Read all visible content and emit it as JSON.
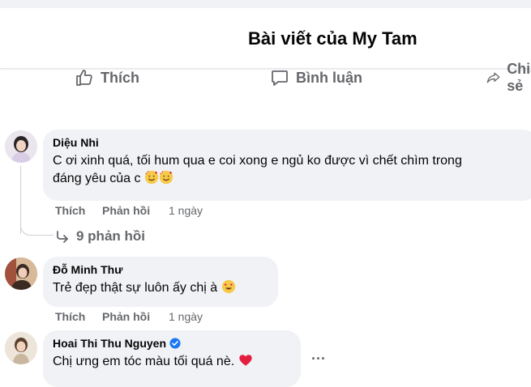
{
  "header": {
    "title": "Bài viết của My Tam"
  },
  "actions": {
    "like": "Thích",
    "comment": "Bình luận",
    "share": "Chia sẻ"
  },
  "comments": [
    {
      "author": "Diệu Nhi",
      "text_line1": "C ơi xinh quá, tối hum qua e coi xong e ngủ ko được vì chết chìm trong",
      "text_line2": "đáng yêu của c",
      "like_label": "Thích",
      "reply_label": "Phản hồi",
      "time": "1 ngày",
      "replies_label": "9 phản hồi"
    },
    {
      "author": "Đỗ Minh Thư",
      "text": "Trẻ đẹp thật sự luôn ấy chị à",
      "like_label": "Thích",
      "reply_label": "Phản hồi",
      "time": "1 ngày"
    },
    {
      "author": "Hoai Thi Thu Nguyen",
      "text": "Chị ưng em tóc màu tối quá nè.",
      "verified": true,
      "more": "..."
    }
  ],
  "icons": {
    "like": "thumbs-up-icon",
    "comment": "speech-bubble-icon",
    "share": "share-arrow-icon",
    "reply_arrow": "reply-arrow-icon",
    "emoji_hearts": "smiling-face-with-hearts-icon",
    "emoji_heart_eyes": "heart-eyes-icon",
    "heart": "red-heart-icon"
  },
  "colors": {
    "secondary_text": "#65676b",
    "bubble": "#f0f2f5",
    "verified": "#1877f2",
    "heart": "#e41e3f"
  }
}
